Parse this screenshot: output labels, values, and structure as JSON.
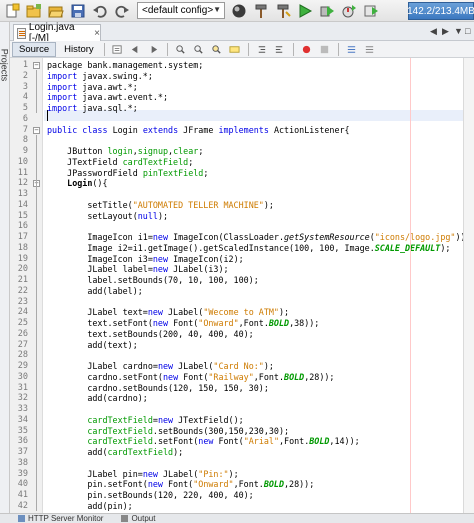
{
  "toolbar": {
    "config_value": "<default config>",
    "memory_label": "142.2/213.4MB",
    "icons": [
      "new-file-icon",
      "new-project-icon",
      "open-project-icon",
      "save-all-icon",
      "undo-icon",
      "redo-icon",
      "config-dropdown",
      "globe-icon",
      "hammer-icon",
      "clean-build-icon",
      "run-icon",
      "debug-icon",
      "profile-icon",
      "apply-code-icon"
    ]
  },
  "side_panel": {
    "projects_label": "Projects"
  },
  "tab": {
    "file_name": "Login.java [-/M]",
    "close": "×"
  },
  "editor_toolbar": {
    "source": "Source",
    "history": "History"
  },
  "lines": [
    {
      "n": "1",
      "segs": [
        [
          "package bank.management.system;",
          ""
        ]
      ]
    },
    {
      "n": "2",
      "segs": [
        [
          "import ",
          "kw"
        ],
        [
          "javax.swing.*;",
          ""
        ]
      ]
    },
    {
      "n": "3",
      "segs": [
        [
          "import ",
          "kw"
        ],
        [
          "java.awt.*;",
          ""
        ]
      ]
    },
    {
      "n": "4",
      "segs": [
        [
          "import ",
          "kw"
        ],
        [
          "java.awt.event.*;",
          ""
        ]
      ]
    },
    {
      "n": "5",
      "segs": [
        [
          "import ",
          "kw"
        ],
        [
          "java.sql.*;",
          ""
        ]
      ]
    },
    {
      "n": "6",
      "segs": [
        [
          "",
          ""
        ]
      ]
    },
    {
      "n": "7",
      "segs": [
        [
          "public class ",
          "kw"
        ],
        [
          "Login ",
          ""
        ],
        [
          "extends ",
          "kw"
        ],
        [
          "JFrame ",
          ""
        ],
        [
          "implements ",
          "kw"
        ],
        [
          "ActionListener{",
          ""
        ]
      ]
    },
    {
      "n": "8",
      "segs": [
        [
          "",
          ""
        ]
      ]
    },
    {
      "n": "9",
      "segs": [
        [
          "    JButton ",
          ""
        ],
        [
          "login",
          "fld"
        ],
        [
          ",",
          ""
        ],
        [
          "signup",
          "fld"
        ],
        [
          ",",
          ""
        ],
        [
          "clear",
          "fld"
        ],
        [
          ";",
          ""
        ]
      ]
    },
    {
      "n": "10",
      "segs": [
        [
          "    JTextField ",
          ""
        ],
        [
          "cardTextField",
          "fld"
        ],
        [
          ";",
          ""
        ]
      ]
    },
    {
      "n": "11",
      "segs": [
        [
          "    JPasswordField ",
          ""
        ],
        [
          "pinTextField",
          "fld"
        ],
        [
          ";",
          ""
        ]
      ]
    },
    {
      "n": "12",
      "segs": [
        [
          "    ",
          ""
        ],
        [
          "Login",
          "b"
        ],
        [
          "(){",
          ""
        ]
      ]
    },
    {
      "n": "13",
      "segs": [
        [
          "",
          ""
        ]
      ]
    },
    {
      "n": "14",
      "segs": [
        [
          "        setTitle(",
          ""
        ],
        [
          "\"AUTOMATED TELLER MACHINE\"",
          "str"
        ],
        [
          ");",
          ""
        ]
      ]
    },
    {
      "n": "15",
      "segs": [
        [
          "        setLayout(",
          ""
        ],
        [
          "null",
          "kw"
        ],
        [
          ");",
          ""
        ]
      ]
    },
    {
      "n": "16",
      "segs": [
        [
          "",
          ""
        ]
      ]
    },
    {
      "n": "17",
      "segs": [
        [
          "        ImageIcon i1=",
          ""
        ],
        [
          "new ",
          "kw"
        ],
        [
          "ImageIcon(ClassLoader.",
          ""
        ],
        [
          "getSystemResource",
          "it"
        ],
        [
          "(",
          ""
        ],
        [
          "\"icons/logo.jpg\"",
          "str"
        ],
        [
          "));",
          ""
        ]
      ]
    },
    {
      "n": "18",
      "segs": [
        [
          "        Image i2=i1.getImage().getScaledInstance(100, 100, Image.",
          ""
        ],
        [
          "SCALE_DEFAULT",
          "sfld"
        ],
        [
          ");",
          ""
        ]
      ]
    },
    {
      "n": "19",
      "segs": [
        [
          "        ImageIcon i3=",
          ""
        ],
        [
          "new ",
          "kw"
        ],
        [
          "ImageIcon(i2);",
          ""
        ]
      ]
    },
    {
      "n": "20",
      "segs": [
        [
          "        JLabel label=",
          ""
        ],
        [
          "new ",
          "kw"
        ],
        [
          "JLabel(i3);",
          ""
        ]
      ]
    },
    {
      "n": "21",
      "segs": [
        [
          "        label.setBounds(70, 10, 100, 100);",
          ""
        ]
      ]
    },
    {
      "n": "22",
      "segs": [
        [
          "        add(label);",
          ""
        ]
      ]
    },
    {
      "n": "23",
      "segs": [
        [
          "",
          ""
        ]
      ]
    },
    {
      "n": "24",
      "segs": [
        [
          "        JLabel text=",
          ""
        ],
        [
          "new ",
          "kw"
        ],
        [
          "JLabel(",
          ""
        ],
        [
          "\"Wecome to ATM\"",
          "str"
        ],
        [
          ");",
          ""
        ]
      ]
    },
    {
      "n": "25",
      "segs": [
        [
          "        text.setFont(",
          ""
        ],
        [
          "new ",
          "kw"
        ],
        [
          "Font(",
          ""
        ],
        [
          "\"Onward\"",
          "str"
        ],
        [
          ",Font.",
          ""
        ],
        [
          "BOLD",
          "sfld"
        ],
        [
          ",38));",
          ""
        ]
      ]
    },
    {
      "n": "26",
      "segs": [
        [
          "        text.setBounds(200, 40, 400, 40);",
          ""
        ]
      ]
    },
    {
      "n": "27",
      "segs": [
        [
          "        add(text);",
          ""
        ]
      ]
    },
    {
      "n": "28",
      "segs": [
        [
          "",
          ""
        ]
      ]
    },
    {
      "n": "29",
      "segs": [
        [
          "        JLabel cardno=",
          ""
        ],
        [
          "new ",
          "kw"
        ],
        [
          "JLabel(",
          ""
        ],
        [
          "\"Card No:\"",
          "str"
        ],
        [
          ");",
          ""
        ]
      ]
    },
    {
      "n": "30",
      "segs": [
        [
          "        cardno.setFont(",
          ""
        ],
        [
          "new ",
          "kw"
        ],
        [
          "Font(",
          ""
        ],
        [
          "\"Railway\"",
          "str"
        ],
        [
          ",Font.",
          ""
        ],
        [
          "BOLD",
          "sfld"
        ],
        [
          ",28));",
          ""
        ]
      ]
    },
    {
      "n": "31",
      "segs": [
        [
          "        cardno.setBounds(120, 150, 150, 30);",
          ""
        ]
      ]
    },
    {
      "n": "32",
      "segs": [
        [
          "        add(cardno);",
          ""
        ]
      ]
    },
    {
      "n": "33",
      "segs": [
        [
          "",
          ""
        ]
      ]
    },
    {
      "n": "34",
      "segs": [
        [
          "        ",
          ""
        ],
        [
          "cardTextField",
          "fld"
        ],
        [
          "=",
          ""
        ],
        [
          "new ",
          "kw"
        ],
        [
          "JTextField();",
          ""
        ]
      ]
    },
    {
      "n": "35",
      "segs": [
        [
          "        ",
          ""
        ],
        [
          "cardTextField",
          "fld"
        ],
        [
          ".setBounds(300,150,230,30);",
          ""
        ]
      ]
    },
    {
      "n": "36",
      "segs": [
        [
          "        ",
          ""
        ],
        [
          "cardTextField",
          "fld"
        ],
        [
          ".setFont(",
          ""
        ],
        [
          "new ",
          "kw"
        ],
        [
          "Font(",
          ""
        ],
        [
          "\"Arial\"",
          "str"
        ],
        [
          ",Font.",
          ""
        ],
        [
          "BOLD",
          "sfld"
        ],
        [
          ",14));",
          ""
        ]
      ]
    },
    {
      "n": "37",
      "segs": [
        [
          "        add(",
          ""
        ],
        [
          "cardTextField",
          "fld"
        ],
        [
          ");",
          ""
        ]
      ]
    },
    {
      "n": "38",
      "segs": [
        [
          "",
          ""
        ]
      ]
    },
    {
      "n": "39",
      "segs": [
        [
          "        JLabel pin=",
          ""
        ],
        [
          "new ",
          "kw"
        ],
        [
          "JLabel(",
          ""
        ],
        [
          "\"Pin:\"",
          "str"
        ],
        [
          ");",
          ""
        ]
      ]
    },
    {
      "n": "40",
      "segs": [
        [
          "        pin.setFont(",
          ""
        ],
        [
          "new ",
          "kw"
        ],
        [
          "Font(",
          ""
        ],
        [
          "\"Onward\"",
          "str"
        ],
        [
          ",Font.",
          ""
        ],
        [
          "BOLD",
          "sfld"
        ],
        [
          ",28));",
          ""
        ]
      ]
    },
    {
      "n": "41",
      "segs": [
        [
          "        pin.setBounds(120, 220, 400, 40);",
          ""
        ]
      ]
    },
    {
      "n": "42",
      "segs": [
        [
          "        add(pin);",
          ""
        ]
      ]
    }
  ],
  "bottom": {
    "http_tab": "HTTP Server Monitor",
    "output_tab": "Output"
  }
}
